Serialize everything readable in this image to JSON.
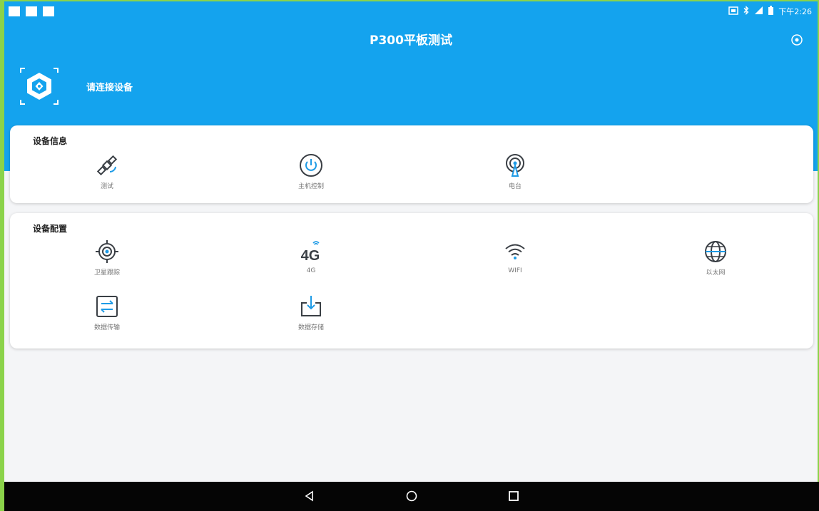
{
  "status_bar": {
    "time": "下午2:26"
  },
  "app": {
    "title": "P300平板测试",
    "connect_prompt": "请连接设备"
  },
  "sections": [
    {
      "title": "设备信息",
      "items": [
        {
          "label": "测试",
          "icon": "satellite-icon"
        },
        {
          "label": "主机控制",
          "icon": "power-icon"
        },
        {
          "label": "电台",
          "icon": "radio-tower-icon"
        }
      ]
    },
    {
      "title": "设备配置",
      "items": [
        {
          "label": "卫星跟踪",
          "icon": "target-icon"
        },
        {
          "label": "4G",
          "icon": "4g-icon",
          "icon_text": "4G"
        },
        {
          "label": "WIFI",
          "icon": "wifi-icon"
        },
        {
          "label": "以太网",
          "icon": "globe-icon"
        },
        {
          "label": "数据传输",
          "icon": "transfer-icon"
        },
        {
          "label": "数据存储",
          "icon": "download-icon"
        }
      ]
    }
  ],
  "colors": {
    "header_blue": "#14a3ee",
    "icon_blue": "#1e9be6",
    "icon_dark": "#3a3f45"
  }
}
